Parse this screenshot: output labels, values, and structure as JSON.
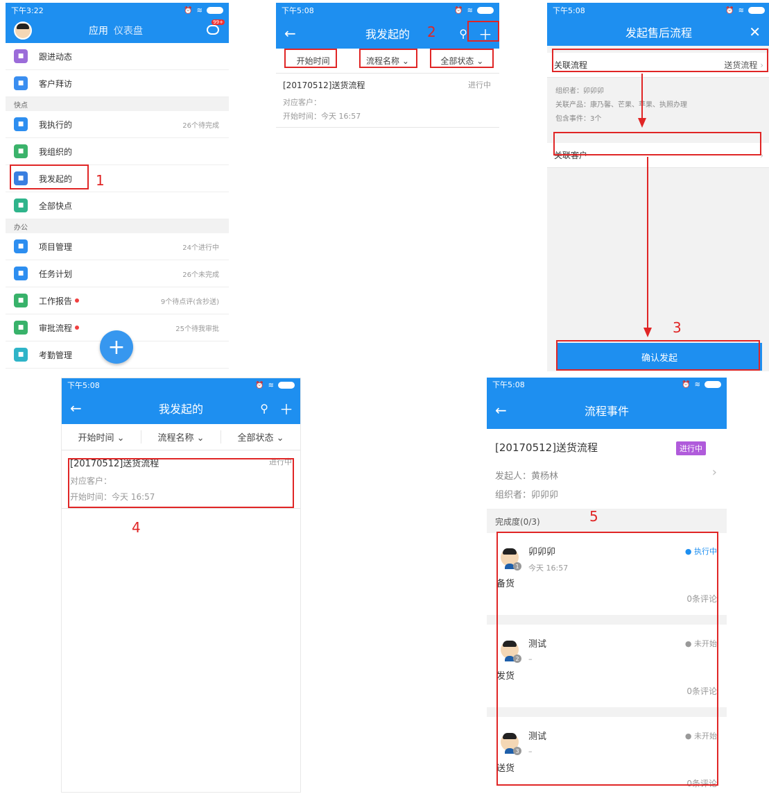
{
  "colors": {
    "primary": "#1e8ff0",
    "annotation": "#e02525",
    "badge": "#b05bdb"
  },
  "panel1": {
    "status_time": "下午3:22",
    "tabs": [
      "应用",
      "仪表盘"
    ],
    "notif_badge": "99+",
    "rows_top": [
      {
        "label": "跟进动态",
        "icon": "person-follow-icon",
        "color": "#9b6cd9",
        "right": ""
      },
      {
        "label": "客户拜访",
        "icon": "location-pin-icon",
        "color": "#3a8ef0",
        "right": ""
      }
    ],
    "section_quick": "快点",
    "rows_quick": [
      {
        "label": "我执行的",
        "icon": "pin-icon",
        "color": "#2d8ef0",
        "right": "26个待完成",
        "dot": false
      },
      {
        "label": "我组织的",
        "icon": "org-chart-icon",
        "color": "#3bb36b",
        "right": "",
        "dot": false
      },
      {
        "label": "我发起的",
        "icon": "send-icon",
        "color": "#3a7fe0",
        "right": "",
        "dot": false
      },
      {
        "label": "全部快点",
        "icon": "layers-icon",
        "color": "#2fb48b",
        "right": "",
        "dot": false
      }
    ],
    "section_office": "办公",
    "rows_office": [
      {
        "label": "项目管理",
        "icon": "folder-icon",
        "color": "#2d8ef0",
        "right": "24个进行中",
        "dot": false
      },
      {
        "label": "任务计划",
        "icon": "flag-icon",
        "color": "#2d8ef0",
        "right": "26个未完成",
        "dot": false
      },
      {
        "label": "工作报告",
        "icon": "report-icon",
        "color": "#38b26a",
        "right": "9个待点评(含抄送)",
        "dot": true
      },
      {
        "label": "审批流程",
        "icon": "stamp-icon",
        "color": "#38b26a",
        "right": "25个待我审批",
        "dot": true
      },
      {
        "label": "考勤管理",
        "icon": "clock-icon",
        "color": "#2fb4c8",
        "right": "",
        "dot": false
      }
    ],
    "annotation": "1"
  },
  "panel2": {
    "status_time": "下午5:08",
    "title": "我发起的",
    "filters": [
      "开始时间",
      "流程名称 ⌄",
      "全部状态 ⌄"
    ],
    "card": {
      "title": "[20170512]送货流程",
      "status": "进行中",
      "customer": "对应客户：",
      "start": "开始时间：今天 16:57"
    },
    "annotation": "2"
  },
  "panel3": {
    "status_time": "下午5:08",
    "title": "发起售后流程",
    "row1_label": "关联流程",
    "row1_value": "送货流程",
    "info": [
      "组织者：卯卯卯",
      "关联产品：康乃馨、芒果、苹果、执照办理",
      "包含事件：3个"
    ],
    "row2_label": "关联客户",
    "confirm": "确认发起",
    "annotation": "3"
  },
  "panel4": {
    "status_time": "下午5:08",
    "title": "我发起的",
    "filters": [
      "开始时间 ⌄",
      "流程名称 ⌄",
      "全部状态 ⌄"
    ],
    "card": {
      "title": "[20170512]送货流程",
      "status": "进行中",
      "customer": "对应客户：",
      "start": "开始时间：今天 16:57"
    },
    "annotation": "4"
  },
  "panel5": {
    "status_time": "下午5:08",
    "title": "流程事件",
    "flow_title": "[20170512]送货流程",
    "flow_status": "进行中",
    "initiator": "发起人：黄杨林",
    "organizer": "组织者：卯卯卯",
    "progress": "完成度(0/3)",
    "annotation": "5",
    "tasks": [
      {
        "num": "1",
        "name": "卯卯卯",
        "time": "今天 16:57",
        "title": "备货",
        "status": "● 执行中",
        "status_color": "#1e8ff0",
        "comments": "0条评论"
      },
      {
        "num": "2",
        "name": "测试",
        "time": "–",
        "title": "发货",
        "status": "● 未开始",
        "status_color": "#999999",
        "comments": "0条评论"
      },
      {
        "num": "3",
        "name": "测试",
        "time": "–",
        "title": "送货",
        "status": "● 未开始",
        "status_color": "#999999",
        "comments": "0条评论"
      }
    ]
  }
}
